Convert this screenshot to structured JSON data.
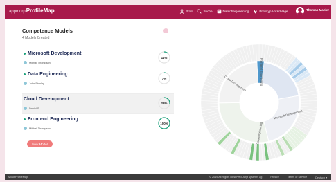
{
  "app": {
    "logo_prefix": "appmorp",
    "logo_name": "ProfileMap"
  },
  "nav": [
    {
      "label": "Profil",
      "icon": "user-icon"
    },
    {
      "label": "Suche",
      "icon": "search-icon"
    },
    {
      "label": "Datenbeigerierung",
      "icon": "database-icon"
    },
    {
      "label": "Prototyp Vorschläge",
      "icon": "location-pin-icon"
    }
  ],
  "user": {
    "name": "Thomas Mahler"
  },
  "panel": {
    "title": "Competence Models",
    "subtitle": "4 Models Created"
  },
  "models": [
    {
      "name": "Microsoft Development",
      "owner": "Mikhail Thompson",
      "progress": 11,
      "progress_label": "11%",
      "active": false
    },
    {
      "name": "Data Engineering",
      "owner": "John Stanley",
      "progress": 7,
      "progress_label": "7%",
      "active": false
    },
    {
      "name": "Cloud Development",
      "owner": "Daniel S.",
      "progress": 28,
      "progress_label": "28%",
      "active": true
    },
    {
      "name": "Frontend Engineering",
      "owner": "Mikhail Thompson",
      "progress": 100,
      "progress_label": "100%",
      "active": false
    }
  ],
  "new_model_label": "New Model",
  "sunburst": {
    "segments": [
      {
        "label": "Frontend Engineering"
      },
      {
        "label": "Microsoft Development"
      },
      {
        "label": "Data Engineering"
      },
      {
        "label": "Cloud Development"
      }
    ]
  },
  "footer": {
    "about": "About ProfileMap",
    "copyright": "© 2019 All Rights Reserved. Anyt systems ag",
    "links": [
      "Privacy",
      "Terms of Service",
      "Deutsch ▾"
    ]
  },
  "colors": {
    "brand": "#a8194b",
    "progress": "#19a07a",
    "new_button": "#f07a7a"
  }
}
